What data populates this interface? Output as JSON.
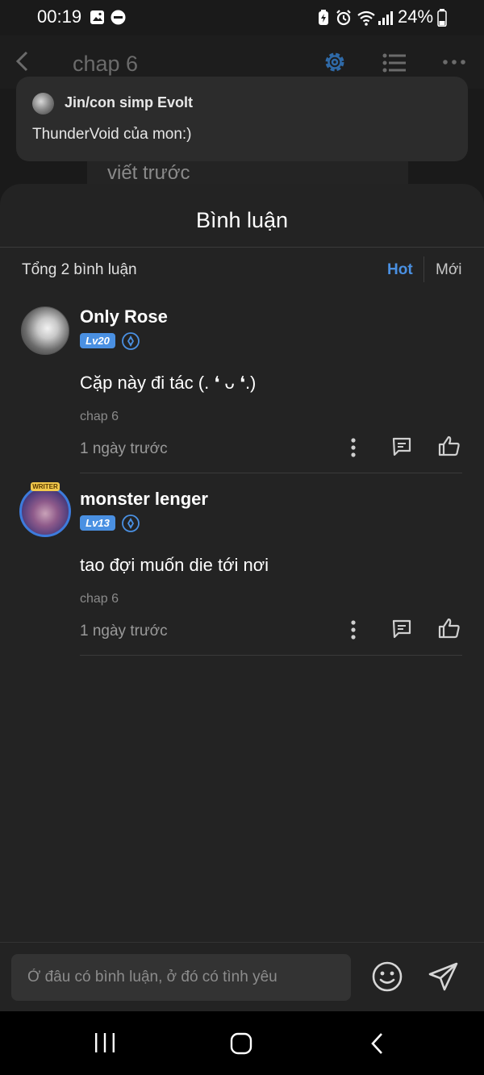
{
  "status_bar": {
    "time": "00:19",
    "battery": "24%"
  },
  "reader": {
    "title": "chap 6",
    "background_text": "viết trước"
  },
  "toast": {
    "name": "Jin/con simp Evolt",
    "message": "ThunderVoid của mon:)"
  },
  "comments_panel": {
    "title": "Bình luận",
    "count_label": "Tổng 2 bình luận",
    "sort_hot": "Hot",
    "sort_new": "Mới",
    "accent_color": "#4a90e2"
  },
  "comments": [
    {
      "name": "Only Rose",
      "level": "Lv20",
      "text": "Cặp này đi tác (. ❛ ᴗ ❛.)",
      "chapter": "chap 6",
      "time": "1 ngày trước"
    },
    {
      "name": "monster lenger",
      "level": "Lv13",
      "badge": "WRITER",
      "text": "tao đợi muốn die tới nơi",
      "chapter": "chap 6",
      "time": "1 ngày trước"
    }
  ],
  "input": {
    "placeholder": "Ở đâu có bình luận, ở đó có tình yêu"
  }
}
